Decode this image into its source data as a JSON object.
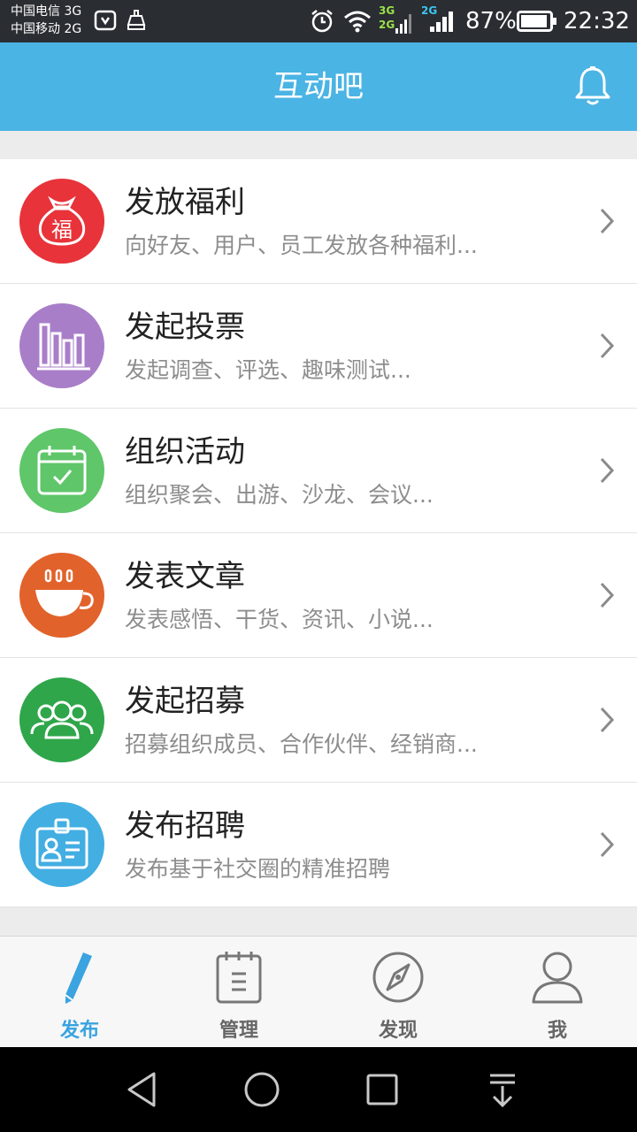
{
  "status_bar": {
    "carrier_1": "中国电信 3G",
    "carrier_2": "中国移动 2G",
    "net_3g": "3G",
    "net_2g_a": "2G",
    "net_2g_b": "2G",
    "battery": "87%",
    "time": "22:32",
    "icons": [
      "huawei-icon",
      "cleaner-icon",
      "alarm-icon",
      "wifi-icon",
      "signal-icon",
      "battery-icon"
    ]
  },
  "header": {
    "title": "互动吧",
    "icon": "bell-icon"
  },
  "items": [
    {
      "title": "发放福利",
      "subtitle": "向好友、用户、员工发放各种福利...",
      "icon": "fu-bag-icon",
      "color": "#e8333a"
    },
    {
      "title": "发起投票",
      "subtitle": "发起调查、评选、趣味测试...",
      "icon": "bar-chart-icon",
      "color": "#a97ec9"
    },
    {
      "title": "组织活动",
      "subtitle": "组织聚会、出游、沙龙、会议...",
      "icon": "calendar-check-icon",
      "color": "#5fc66a"
    },
    {
      "title": "发表文章",
      "subtitle": "发表感悟、干货、资讯、小说...",
      "icon": "coffee-cup-icon",
      "color": "#e2622b"
    },
    {
      "title": "发起招募",
      "subtitle": "招募组织成员、合作伙伴、经销商...",
      "icon": "group-icon",
      "color": "#2fa64a"
    },
    {
      "title": "发布招聘",
      "subtitle": "发布基于社交圈的精准招聘",
      "icon": "id-badge-icon",
      "color": "#42aee2"
    }
  ],
  "tabs": [
    {
      "label": "发布",
      "icon": "pen-icon",
      "active": true
    },
    {
      "label": "管理",
      "icon": "notepad-icon",
      "active": false
    },
    {
      "label": "发现",
      "icon": "compass-icon",
      "active": false
    },
    {
      "label": "我",
      "icon": "person-icon",
      "active": false
    }
  ],
  "nav": [
    "back-icon",
    "home-icon",
    "recents-icon",
    "notification-pull-icon"
  ],
  "colors": {
    "header": "#4ab4e4",
    "active_tab": "#3aa3e0",
    "inactive_tab": "#666666"
  }
}
